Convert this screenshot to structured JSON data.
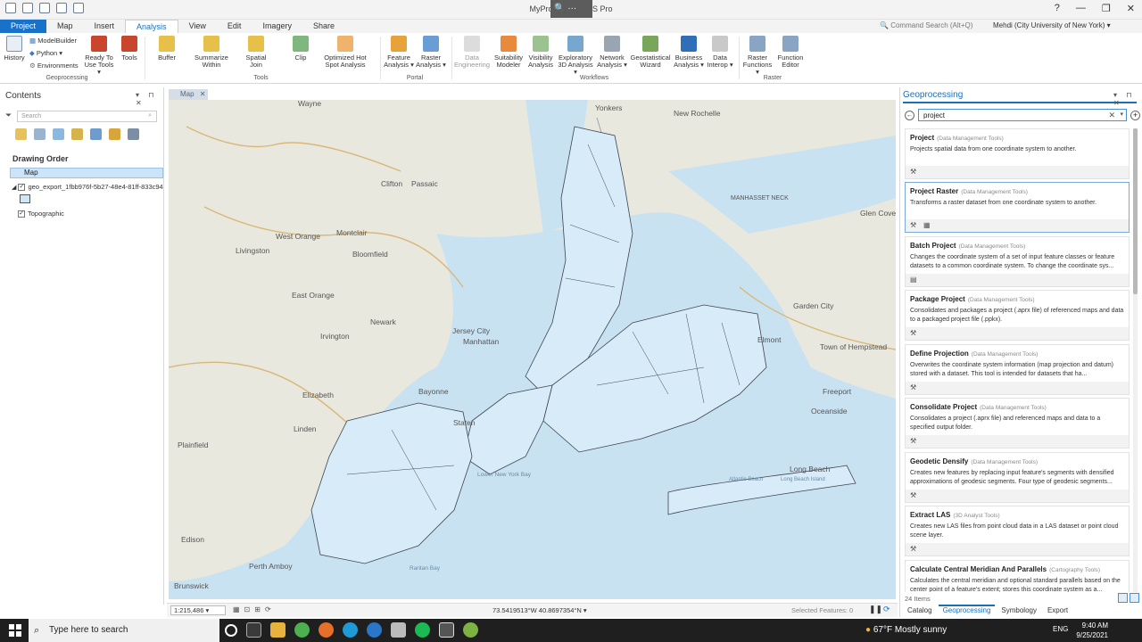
{
  "app": {
    "title": "MyProject - ArcGIS Pro",
    "window_controls": [
      "?",
      "—",
      "❐",
      "✕"
    ]
  },
  "ribbon_tabs": [
    "Project",
    "Map",
    "Insert",
    "Analysis",
    "View",
    "Edit",
    "Imagery",
    "Share"
  ],
  "command_search": "Command Search (Alt+Q)",
  "user": "Mehdi (City University of New York) ▾",
  "ribbon": {
    "history": "History",
    "modelbuilder": "ModelBuilder",
    "python": "Python ▾",
    "environments": "Environments",
    "ready_to_use": "Ready To Use Tools ▾",
    "tools": "Tools",
    "geoprocessing_group": "Geoprocessing",
    "buffer": "Buffer",
    "summarize_within": "Summarize Within",
    "spatial_join": "Spatial Join",
    "clip": "Clip",
    "hotspot": "Optimized Hot Spot Analysis",
    "tools_group": "Tools",
    "feature_analysis": "Feature Analysis ▾",
    "raster_analysis": "Raster Analysis ▾",
    "portal_group": "Portal",
    "data_engineering": "Data Engineering",
    "suitability": "Suitability Modeler",
    "visibility": "Visibility Analysis",
    "exploratory3d": "Exploratory 3D Analysis ▾",
    "network": "Network Analysis ▾",
    "geostatistical": "Geostatistical Wizard",
    "business": "Business Analysis ▾",
    "interop": "Data Interop ▾",
    "workflows_group": "Workflows",
    "raster_functions": "Raster Functions ▾",
    "function_editor": "Function Editor",
    "raster_group": "Raster"
  },
  "contents": {
    "title": "Contents",
    "search_placeholder": "Search",
    "drawing_order": "Drawing Order",
    "map_name": "Map",
    "layer1": "geo_export_1fbb976f-5b27-48e4-81ff-833c94",
    "layer2": "Topographic"
  },
  "map_view": {
    "tab": "Map",
    "scale": "1:215,486",
    "coordinates": "73.5419513°W 40.8697354°N",
    "selected_features": "Selected Features: 0",
    "places": [
      "Wayne",
      "Yonkers",
      "New Rochelle",
      "Clifton",
      "Passaic",
      "Montclair",
      "West Orange",
      "Livingston",
      "Bloomfield",
      "East Orange",
      "Newark",
      "Irvington",
      "Jersey City",
      "Manhattan",
      "Elizabeth",
      "Bayonne",
      "Staten",
      "Linden",
      "Plainfield",
      "Edison",
      "Perth Amboy",
      "Brunswick",
      "MANHASSET NECK",
      "Glen Cove",
      "Garden City",
      "Elmont",
      "Town of Hempstead",
      "Freeport",
      "Oceanside",
      "Long Beach",
      "Raritan Bay",
      "Lower New York Bay",
      "Atlantic Beach",
      "Long Beach Island"
    ]
  },
  "geoprocessing": {
    "title": "Geoprocessing",
    "search_value": "project",
    "item_count": "24 Items",
    "results": [
      {
        "name": "Project",
        "toolbox": "(Data Management Tools)",
        "desc": "Projects spatial data from one coordinate system to another."
      },
      {
        "name": "Project Raster",
        "toolbox": "(Data Management Tools)",
        "desc": "Transforms a raster dataset from one coordinate system to another."
      },
      {
        "name": "Batch Project",
        "toolbox": "(Data Management Tools)",
        "desc": "Changes the coordinate system of a set of input feature classes or feature datasets to a common coordinate system. To change the coordinate sys..."
      },
      {
        "name": "Package Project",
        "toolbox": "(Data Management Tools)",
        "desc": "Consolidates and packages a project (.aprx file) of referenced maps and data to a packaged project file (.ppkx)."
      },
      {
        "name": "Define Projection",
        "toolbox": "(Data Management Tools)",
        "desc": "Overwrites the coordinate system information (map projection and datum) stored with a dataset. This tool is intended for datasets that ha..."
      },
      {
        "name": "Consolidate Project",
        "toolbox": "(Data Management Tools)",
        "desc": "Consolidates a project (.aprx file) and referenced maps and data to a specified output folder."
      },
      {
        "name": "Geodetic Densify",
        "toolbox": "(Data Management Tools)",
        "desc": "Creates new features by replacing input feature's segments with densified approximations of geodesic segments. Four type of geodesic segments..."
      },
      {
        "name": "Extract LAS",
        "toolbox": "(3D Analyst Tools)",
        "desc": "Creates new LAS files from point cloud data in a LAS dataset or point cloud scene layer."
      },
      {
        "name": "Calculate Central Meridian And Parallels",
        "toolbox": "(Cartography Tools)",
        "desc": "Calculates the central meridian and optional standard parallels based on the center point of a feature's extent; stores this coordinate system as a..."
      }
    ],
    "bottom_tabs": [
      "Catalog",
      "Geoprocessing",
      "Symbology",
      "Export"
    ]
  },
  "taskbar": {
    "search_placeholder": "Type here to search",
    "weather": "67°F  Mostly sunny",
    "lang": "ENG",
    "time": "9:40 AM",
    "date": "9/25/2021"
  }
}
